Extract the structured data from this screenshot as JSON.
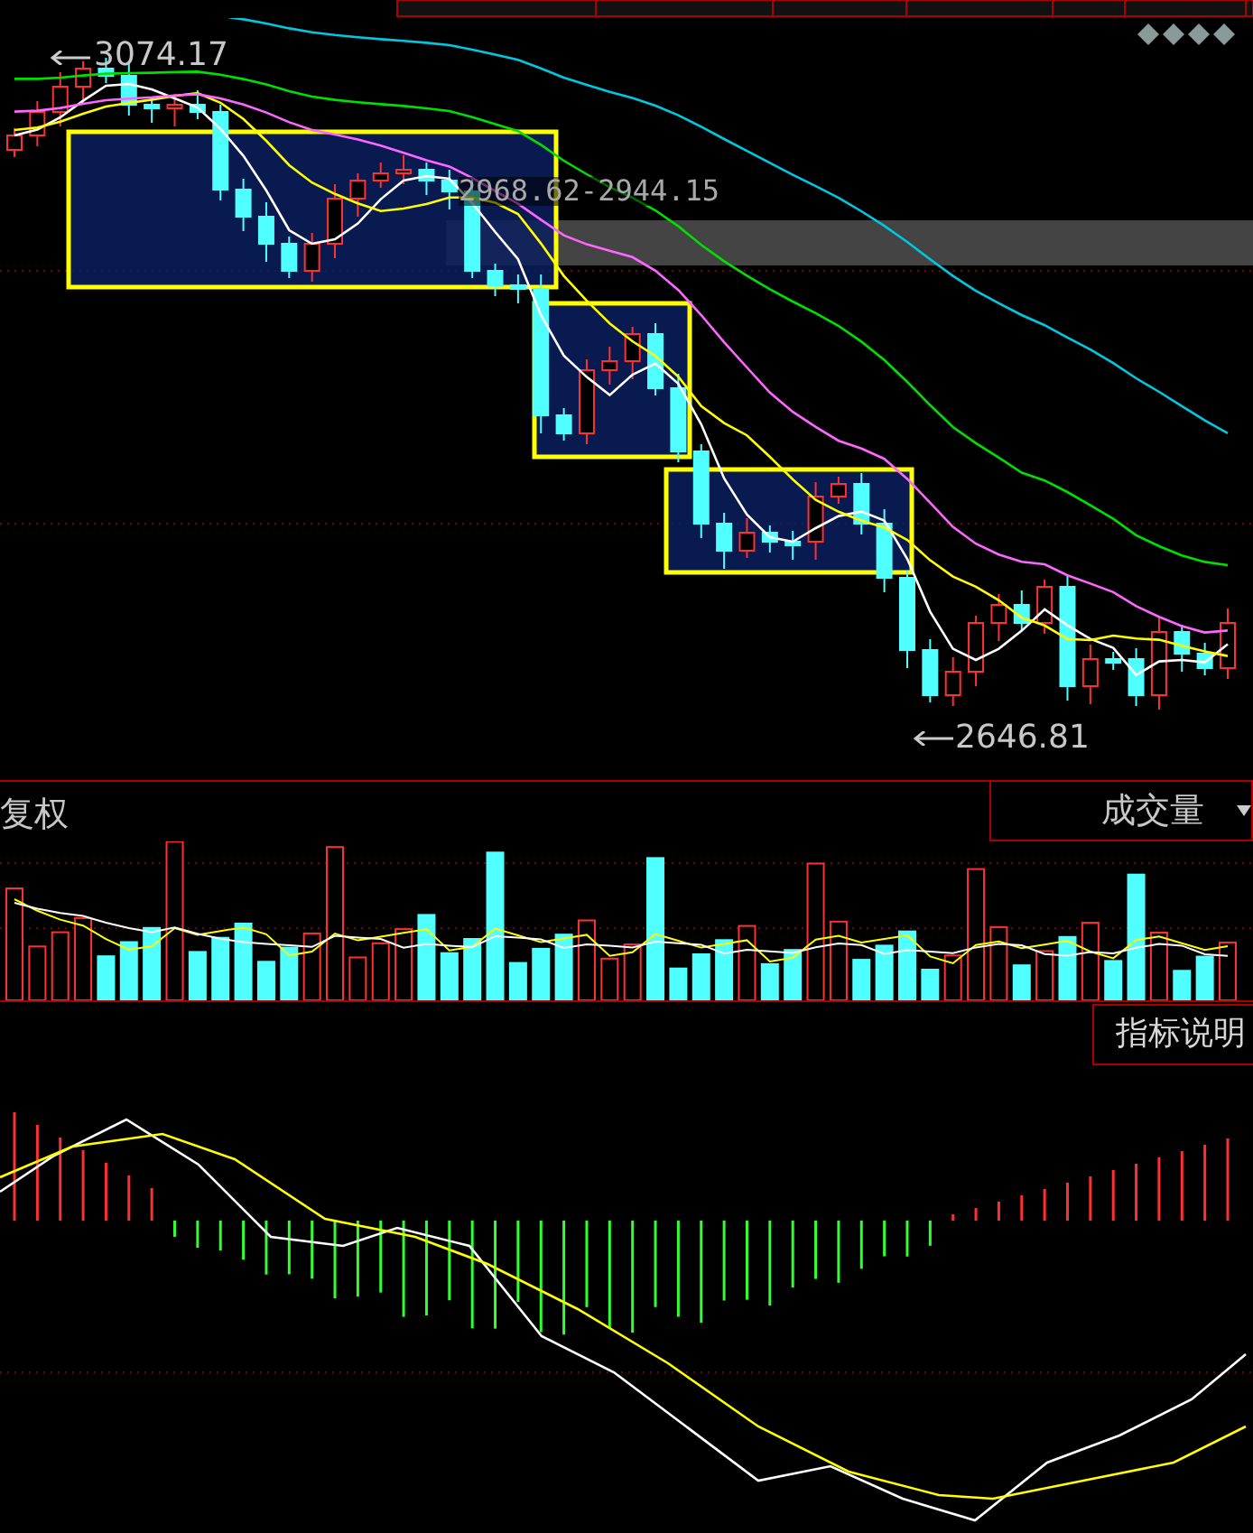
{
  "price_chart": {
    "high_label": "3074.17",
    "range_label": "2968.62-2944.15",
    "low_label": "2646.81"
  },
  "toolbar": {
    "left_label": "复权",
    "indicator_select": "成交量"
  },
  "indicator_button": "指标说明"
}
